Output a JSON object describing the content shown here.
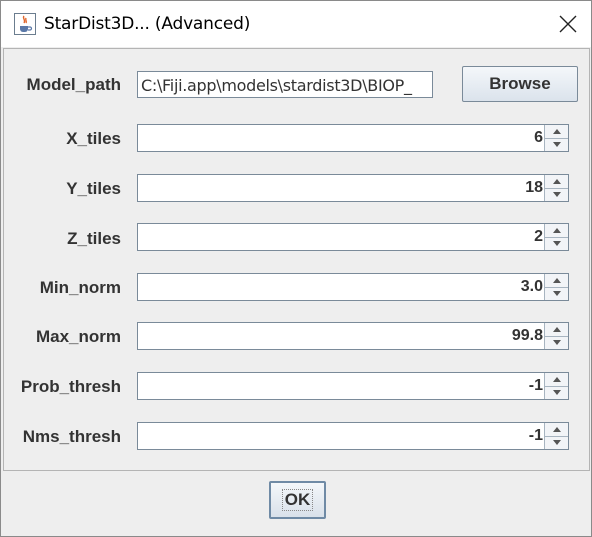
{
  "window": {
    "title": "StarDist3D... (Advanced)"
  },
  "model_path": {
    "label": "Model_path",
    "value": "C:\\Fiji.app\\models\\stardist3D\\BIOP_",
    "browse_label": "Browse"
  },
  "fields": [
    {
      "label": "X_tiles",
      "value": "6"
    },
    {
      "label": "Y_tiles",
      "value": "18"
    },
    {
      "label": "Z_tiles",
      "value": "2"
    },
    {
      "label": "Min_norm",
      "value": "3.0"
    },
    {
      "label": "Max_norm",
      "value": "99.8"
    },
    {
      "label": "Prob_thresh",
      "value": "-1"
    },
    {
      "label": "Nms_thresh",
      "value": "-1"
    }
  ],
  "ok_label": "OK",
  "icons": {
    "app": "java-cup-icon",
    "close": "close-icon",
    "spin_up": "spinner-up-arrow-icon",
    "spin_down": "spinner-down-arrow-icon"
  }
}
